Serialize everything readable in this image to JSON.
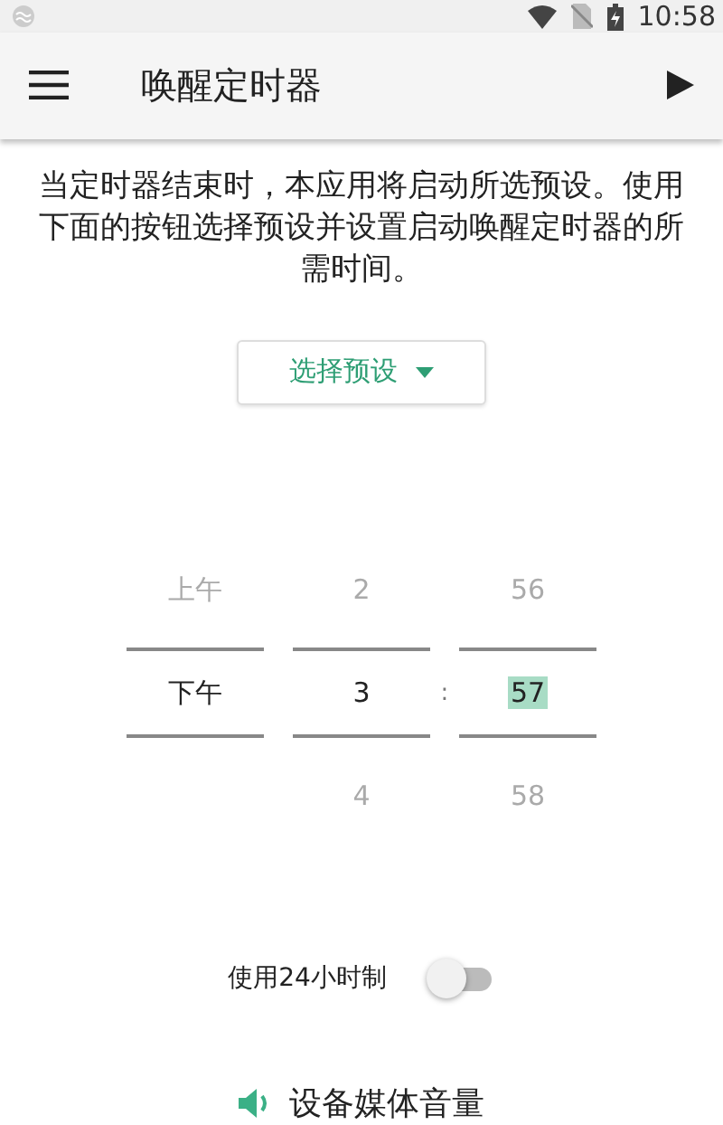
{
  "status_bar": {
    "time": "10:58"
  },
  "toolbar": {
    "title": "唤醒定时器"
  },
  "description": "当定时器结束时，本应用将启动所选预设。使用下面的按钮选择预设并设置启动唤醒定时器的所需时间。",
  "preset_button": {
    "label": "选择预设"
  },
  "time_picker": {
    "separator": ":",
    "columns": [
      {
        "editing": false,
        "items": [
          {
            "value": "上午",
            "selected": false
          },
          {
            "value": "下午",
            "selected": true
          }
        ]
      },
      {
        "editing": false,
        "items": [
          {
            "value": "2",
            "selected": false
          },
          {
            "value": "3",
            "selected": true
          },
          {
            "value": "4",
            "selected": false
          }
        ]
      },
      {
        "editing": true,
        "items": [
          {
            "value": "56",
            "selected": false
          },
          {
            "value": "57",
            "selected": true
          },
          {
            "value": "58",
            "selected": false
          }
        ]
      }
    ]
  },
  "clock_24h": {
    "label": "使用24小时制",
    "on": false
  },
  "volume": {
    "label": "设备媒体音量"
  }
}
